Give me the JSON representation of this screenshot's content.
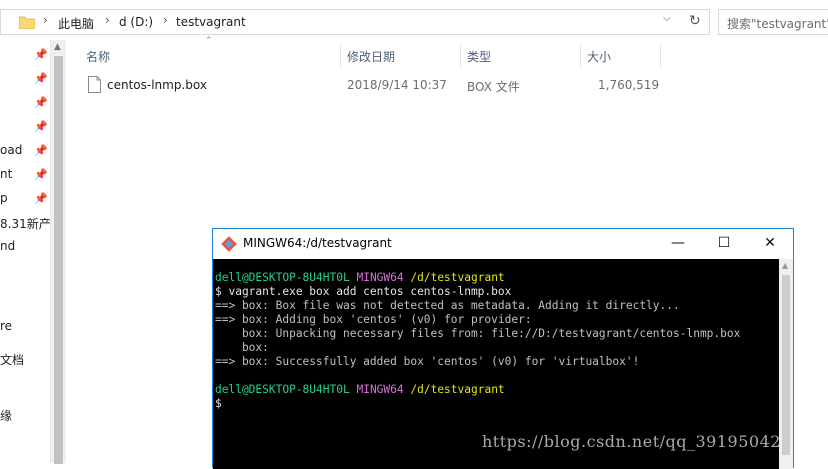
{
  "address_bar": {
    "segments": [
      "此电脑",
      "d (D:)",
      "testvagrant"
    ]
  },
  "search": {
    "placeholder": "搜索\"testvagrant\""
  },
  "nav": {
    "items": [
      "oad",
      "nt",
      "p",
      "8.31新产",
      "nd",
      "re",
      "文档",
      "缘"
    ]
  },
  "columns": {
    "name": "名称",
    "modified": "修改日期",
    "type": "类型",
    "size": "大小"
  },
  "files": [
    {
      "name": "centos-lnmp.box",
      "modified": "2018/9/14 10:37",
      "type": "BOX 文件",
      "size": "1,760,519"
    }
  ],
  "terminal": {
    "title": "MINGW64:/d/testvagrant",
    "controls": {
      "minimize": "—",
      "maximize": "☐",
      "close": "✕"
    },
    "prompt_user": "dell@DESKTOP-8U4HT0L",
    "prompt_env": "MINGW64",
    "prompt_path": "/d/testvagrant",
    "command": "$ vagrant.exe box add centos centos-lnmp.box",
    "output": [
      "==> box: Box file was not detected as metadata. Adding it directly...",
      "==> box: Adding box 'centos' (v0) for provider:",
      "    box: Unpacking necessary files from: file://D:/testvagrant/centos-lnmp.box",
      "    box:",
      "==> box: Successfully added box 'centos' (v0) for 'virtualbox'!"
    ],
    "prompt2_user": "dell@DESKTOP-8U4HT0L",
    "prompt2_env": "MINGW64",
    "prompt2_path": "/d/testvagrant",
    "cursor_line": "$"
  },
  "watermark": "https://blog.csdn.net/qq_39195042"
}
